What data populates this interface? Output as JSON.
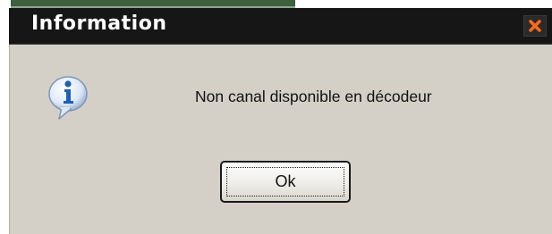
{
  "dialog": {
    "title": "Information",
    "message": "Non canal disponible en décodeur",
    "ok_label": "Ok",
    "icon": "info-speech-bubble-icon",
    "close_icon": "close-x-icon"
  },
  "colors": {
    "titlebar_bg": "#161616",
    "title_text": "#ffffff",
    "close_x": "#ff6a1a",
    "dialog_bg": "#d4d0c8",
    "icon_blue": "#1f5fb5"
  }
}
